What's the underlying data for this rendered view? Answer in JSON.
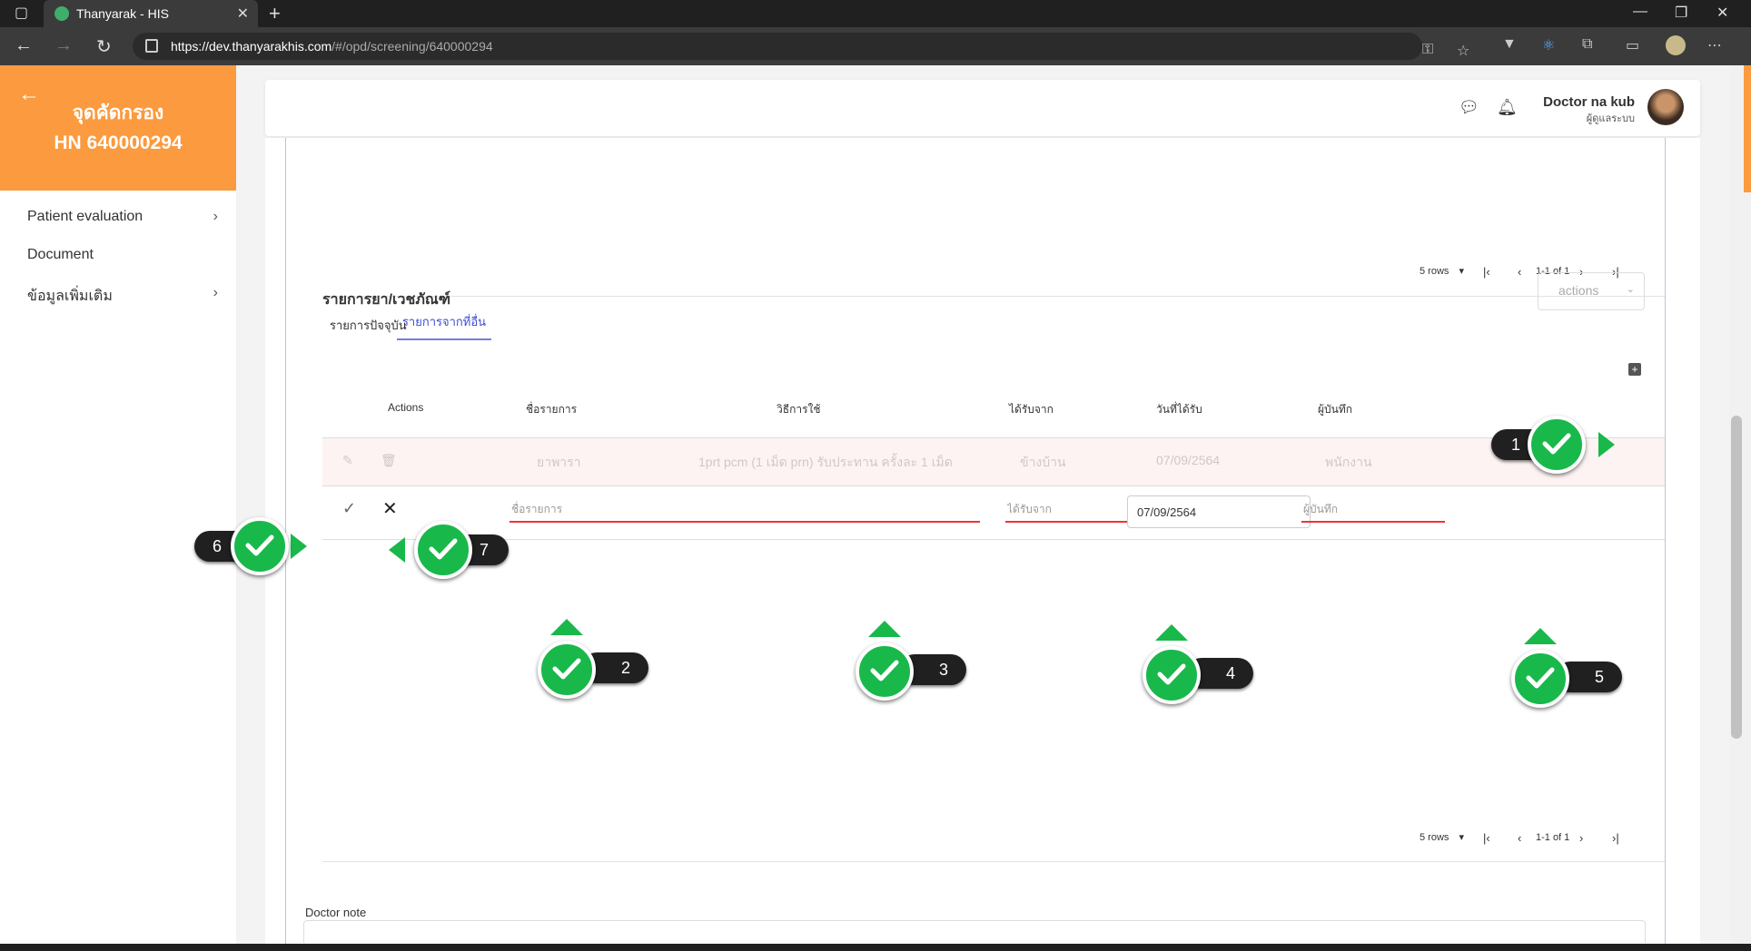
{
  "browser": {
    "tab_title": "Thanyarak - HIS",
    "url_host": "https://dev.thanyarakhis.com",
    "url_path": "/#/opd/screening/640000294"
  },
  "sidebar": {
    "title": "จุดคัดกรอง",
    "hn": "HN 640000294",
    "items": [
      {
        "label": "Patient evaluation",
        "chevron": "›"
      },
      {
        "label": "Document",
        "chevron": ""
      },
      {
        "label": "ข้อมูลเพิ่มเติม",
        "chevron": "›"
      }
    ]
  },
  "header": {
    "user_name": "Doctor na kub",
    "user_role": "ผู้ดูแลระบบ"
  },
  "pager_top": {
    "rows": "5 rows",
    "range": "1-1 of 1"
  },
  "pager_bottom": {
    "rows": "5 rows",
    "range": "1-1 of 1"
  },
  "section": {
    "title": "รายการยา/เวชภัณฑ์",
    "actions_label": "actions",
    "tabs": [
      "รายการปัจจุบัน",
      "รายการจากที่อื่น"
    ]
  },
  "table": {
    "headers": [
      "Actions",
      "ชื่อรายการ",
      "วิธีการใช้",
      "ได้รับจาก",
      "วันที่ได้รับ",
      "ผู้บันทึก"
    ],
    "row": [
      "ยาพารา",
      "1prt pcm (1 เม็ด prn) รับประทาน ครั้งละ 1 เม็ด",
      "ข้างบ้าน",
      "07/09/2564",
      "พนักงาน"
    ],
    "edit": {
      "name_placeholder": "ชื่อรายการ",
      "from_placeholder": "ได้รับจาก",
      "date_value": "07/09/2564",
      "recorder_placeholder": "ผู้บันทึก"
    }
  },
  "doctor_note_label": "Doctor note",
  "annotations": [
    "1",
    "2",
    "3",
    "4",
    "5",
    "6",
    "7"
  ],
  "colors": {
    "brand": "#fb9a3e",
    "accent": "#3a4dd8",
    "marker": "#19b84b",
    "error": "#ee3333"
  }
}
